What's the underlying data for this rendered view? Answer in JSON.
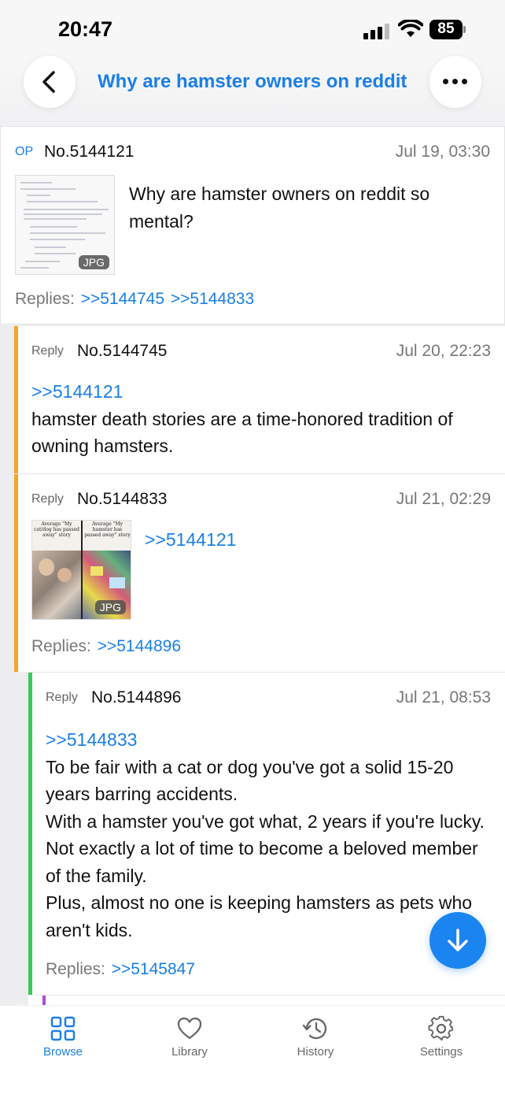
{
  "status": {
    "time": "20:47",
    "battery": "85"
  },
  "header": {
    "title": "Why are hamster owners on reddit so mental?"
  },
  "colors": {
    "accent": "#1a7fe6",
    "orange": "#f5a623",
    "green": "#3cc85a",
    "purple": "#b44ad9"
  },
  "posts": [
    {
      "tag": "OP",
      "no": "No.5144121",
      "date": "Jul 19, 03:30",
      "image_badge": "JPG",
      "text": "Why are hamster owners on reddit so mental?",
      "replies_label": "Replies:",
      "replies": [
        ">>5144745",
        ">>5144833"
      ]
    },
    {
      "tag": "Reply",
      "no": "No.5144745",
      "date": "Jul 20, 22:23",
      "quote": ">>5144121",
      "text": "hamster death stories are a time-honored tradition of owning hamsters."
    },
    {
      "tag": "Reply",
      "no": "No.5144833",
      "date": "Jul 21, 02:29",
      "image_badge": "JPG",
      "image_captions": [
        "Average \"My cat/dog has passed away\" story",
        "Average \"My hamster has passed away\" story"
      ],
      "quote": ">>5144121",
      "replies_label": "Replies:",
      "replies": [
        ">>5144896"
      ]
    },
    {
      "tag": "Reply",
      "no": "No.5144896",
      "date": "Jul 21, 08:53",
      "quote": ">>5144833",
      "lines": [
        "To be fair with a cat or dog you've got a solid 15-20 years barring accidents.",
        "With a hamster you've got what, 2 years if you're lucky. Not exactly a lot of time to become a beloved member of the family.",
        "Plus, almost no one is keeping hamsters as pets who aren't kids."
      ],
      "replies_label": "Replies:",
      "replies": [
        ">>5145847"
      ]
    }
  ],
  "tabs": [
    {
      "label": "Browse",
      "icon": "grid-icon"
    },
    {
      "label": "Library",
      "icon": "heart-icon"
    },
    {
      "label": "History",
      "icon": "history-icon"
    },
    {
      "label": "Settings",
      "icon": "gear-icon"
    }
  ]
}
